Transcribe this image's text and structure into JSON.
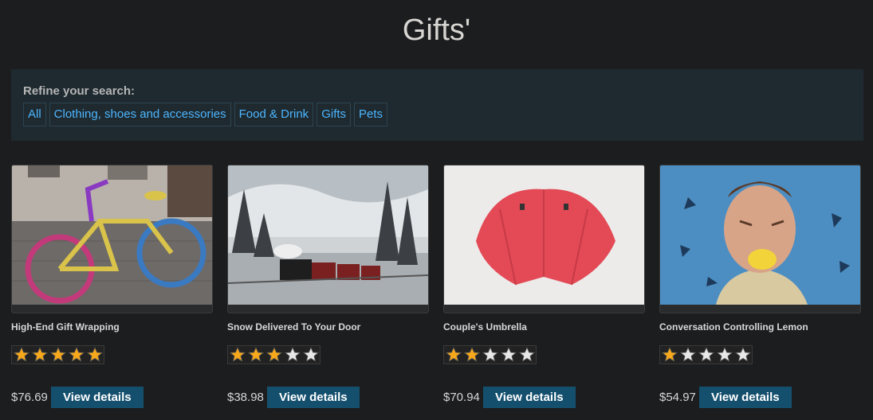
{
  "page": {
    "title": "Gifts'"
  },
  "filters": {
    "label": "Refine your search:",
    "items": [
      "All",
      "Clothing, shoes and accessories",
      "Food & Drink",
      "Gifts",
      "Pets"
    ]
  },
  "products": [
    {
      "name": "High-End Gift Wrapping",
      "rating": 5,
      "price": "$76.69",
      "button": "View details",
      "image": "knitted-bicycle"
    },
    {
      "name": "Snow Delivered To Your Door",
      "rating": 3,
      "price": "$38.98",
      "button": "View details",
      "image": "steam-train-snow"
    },
    {
      "name": "Couple's Umbrella",
      "rating": 2,
      "price": "$70.94",
      "button": "View details",
      "image": "red-double-umbrella"
    },
    {
      "name": "Conversation Controlling Lemon",
      "rating": 1,
      "price": "$54.97",
      "button": "View details",
      "image": "man-biting-lemon"
    }
  ],
  "colors": {
    "accent": "#4db5ff",
    "button": "#14506e",
    "star": "#f7a81b"
  }
}
